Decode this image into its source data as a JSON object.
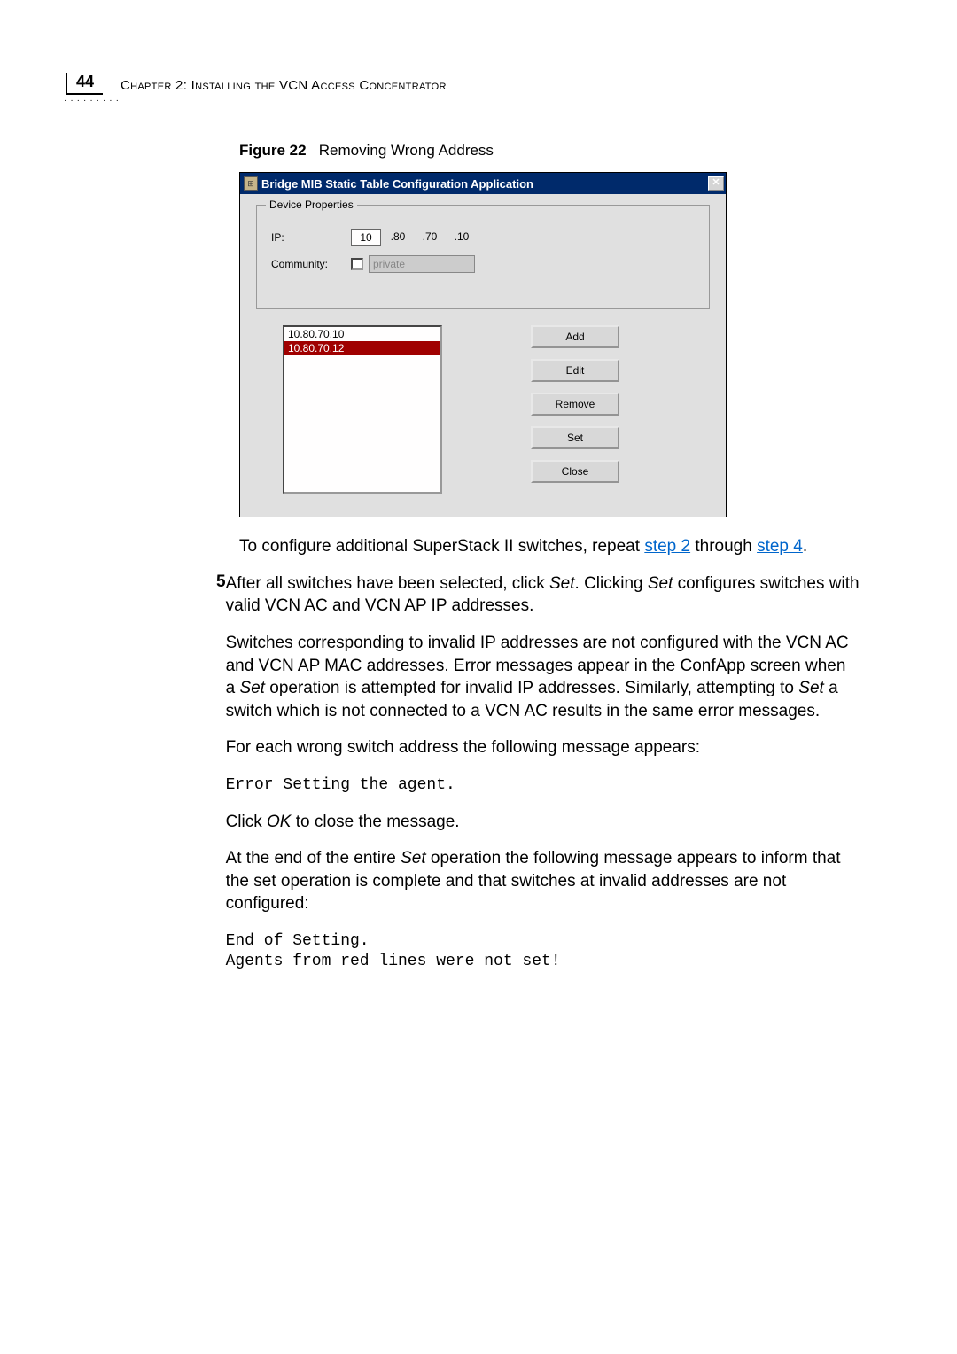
{
  "header": {
    "page_number": "44",
    "chapter": "Chapter 2: Installing the VCN Access Concentrator"
  },
  "figure": {
    "label": "Figure 22",
    "caption": "Removing Wrong Address"
  },
  "dialog": {
    "title": "Bridge MIB Static Table Configuration Application",
    "group_title": "Device Properties",
    "ip_label": "IP:",
    "ip_octets": [
      "10",
      ".80",
      ".70",
      ".10"
    ],
    "community_label": "Community:",
    "community_value": "private",
    "list_items": [
      "10.80.70.10",
      "10.80.70.12"
    ],
    "buttons": {
      "add": "Add",
      "edit": "Edit",
      "remove": "Remove",
      "set": "Set",
      "close": "Close"
    }
  },
  "body": {
    "p1_a": "To configure additional SuperStack II switches, repeat ",
    "p1_link1": "step 2",
    "p1_b": " through ",
    "p1_link2": "step 4",
    "p1_c": ".",
    "step5_num": "5",
    "step5_a": "After all switches have been selected, click ",
    "step5_i1": "Set",
    "step5_b": ". Clicking ",
    "step5_i2": "Set",
    "step5_c": " configures switches with valid VCN AC and VCN AP IP addresses.",
    "p2_a": "Switches corresponding to invalid IP addresses are not configured with the VCN AC and VCN AP MAC addresses. Error messages appear in the ConfApp screen when a ",
    "p2_i1": "Set",
    "p2_b": " operation is attempted for invalid IP addresses. Similarly, attempting to ",
    "p2_i2": "Set",
    "p2_c": " a switch which is not connected to a VCN AC results in the same error messages.",
    "p3": "For each wrong switch address the following message appears:",
    "code1": "Error Setting the agent.",
    "p4_a": "Click ",
    "p4_i": "OK",
    "p4_b": " to close the message.",
    "p5_a": "At the end of the entire ",
    "p5_i": "Set",
    "p5_b": " operation the following message appears to inform that the set operation is complete and that switches at invalid addresses are not configured:",
    "code2": "End of Setting.\nAgents from red lines were not set!"
  }
}
